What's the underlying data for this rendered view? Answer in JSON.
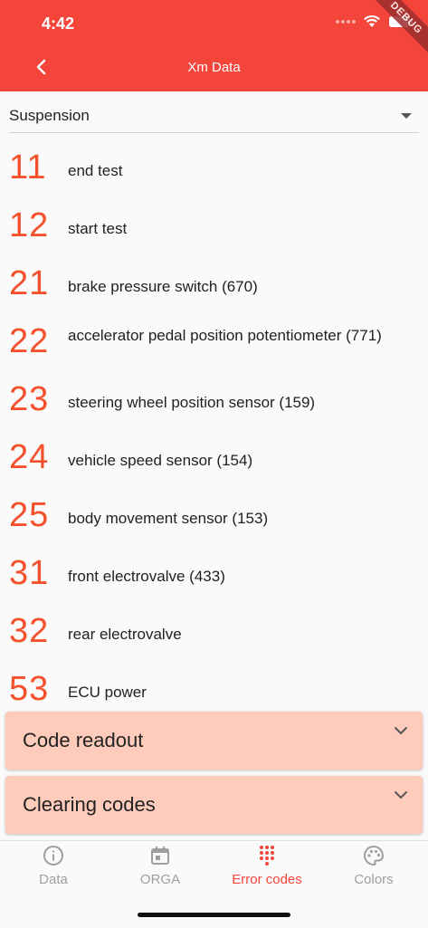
{
  "status": {
    "time": "4:42",
    "debug": "DEBUG"
  },
  "appbar": {
    "title": "Xm Data"
  },
  "dropdown": {
    "selected": "Suspension"
  },
  "codes": [
    {
      "code": "11",
      "desc": "end test"
    },
    {
      "code": "12",
      "desc": "start test"
    },
    {
      "code": "21",
      "desc": "brake pressure switch (670)"
    },
    {
      "code": "22",
      "desc": "accelerator pedal position potentiometer (771)"
    },
    {
      "code": "23",
      "desc": "steering wheel position sensor (159)"
    },
    {
      "code": "24",
      "desc": "vehicle speed sensor (154)"
    },
    {
      "code": "25",
      "desc": "body movement sensor (153)"
    },
    {
      "code": "31",
      "desc": "front electrovalve (433)"
    },
    {
      "code": "32",
      "desc": "rear electrovalve"
    },
    {
      "code": "53",
      "desc": "ECU power"
    }
  ],
  "panels": [
    {
      "label": "Code readout"
    },
    {
      "label": "Clearing codes"
    }
  ],
  "nav": [
    {
      "label": "Data",
      "icon": "info-icon"
    },
    {
      "label": "ORGA",
      "icon": "calendar-icon"
    },
    {
      "label": "Error codes",
      "icon": "dot-grid-icon",
      "active": true
    },
    {
      "label": "Colors",
      "icon": "palette-icon"
    }
  ],
  "colors": {
    "accent": "#f4453b",
    "code": "#f4512c",
    "panel": "#ffcbbb"
  }
}
